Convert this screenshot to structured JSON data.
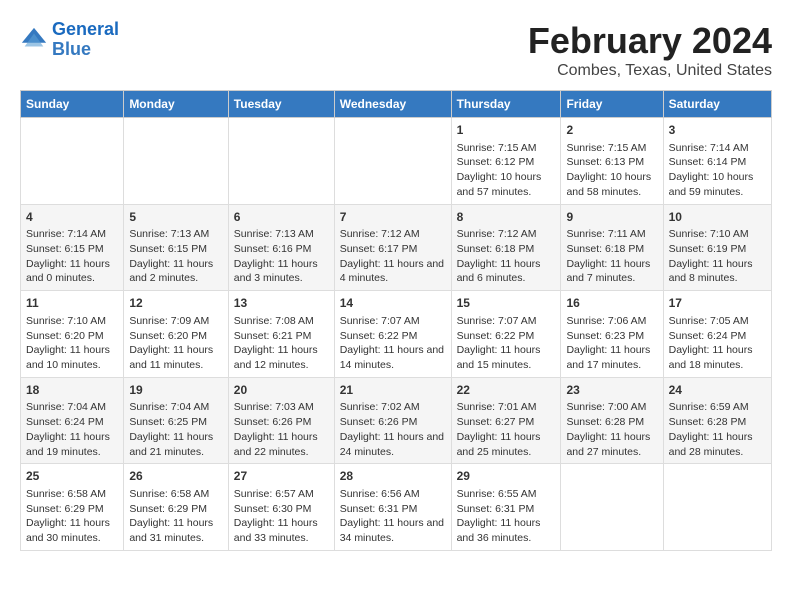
{
  "header": {
    "logo_line1": "General",
    "logo_line2": "Blue",
    "title": "February 2024",
    "subtitle": "Combes, Texas, United States"
  },
  "days_of_week": [
    "Sunday",
    "Monday",
    "Tuesday",
    "Wednesday",
    "Thursday",
    "Friday",
    "Saturday"
  ],
  "weeks": [
    [
      {
        "day": "",
        "info": ""
      },
      {
        "day": "",
        "info": ""
      },
      {
        "day": "",
        "info": ""
      },
      {
        "day": "",
        "info": ""
      },
      {
        "day": "1",
        "info": "Sunrise: 7:15 AM\nSunset: 6:12 PM\nDaylight: 10 hours and 57 minutes."
      },
      {
        "day": "2",
        "info": "Sunrise: 7:15 AM\nSunset: 6:13 PM\nDaylight: 10 hours and 58 minutes."
      },
      {
        "day": "3",
        "info": "Sunrise: 7:14 AM\nSunset: 6:14 PM\nDaylight: 10 hours and 59 minutes."
      }
    ],
    [
      {
        "day": "4",
        "info": "Sunrise: 7:14 AM\nSunset: 6:15 PM\nDaylight: 11 hours and 0 minutes."
      },
      {
        "day": "5",
        "info": "Sunrise: 7:13 AM\nSunset: 6:15 PM\nDaylight: 11 hours and 2 minutes."
      },
      {
        "day": "6",
        "info": "Sunrise: 7:13 AM\nSunset: 6:16 PM\nDaylight: 11 hours and 3 minutes."
      },
      {
        "day": "7",
        "info": "Sunrise: 7:12 AM\nSunset: 6:17 PM\nDaylight: 11 hours and 4 minutes."
      },
      {
        "day": "8",
        "info": "Sunrise: 7:12 AM\nSunset: 6:18 PM\nDaylight: 11 hours and 6 minutes."
      },
      {
        "day": "9",
        "info": "Sunrise: 7:11 AM\nSunset: 6:18 PM\nDaylight: 11 hours and 7 minutes."
      },
      {
        "day": "10",
        "info": "Sunrise: 7:10 AM\nSunset: 6:19 PM\nDaylight: 11 hours and 8 minutes."
      }
    ],
    [
      {
        "day": "11",
        "info": "Sunrise: 7:10 AM\nSunset: 6:20 PM\nDaylight: 11 hours and 10 minutes."
      },
      {
        "day": "12",
        "info": "Sunrise: 7:09 AM\nSunset: 6:20 PM\nDaylight: 11 hours and 11 minutes."
      },
      {
        "day": "13",
        "info": "Sunrise: 7:08 AM\nSunset: 6:21 PM\nDaylight: 11 hours and 12 minutes."
      },
      {
        "day": "14",
        "info": "Sunrise: 7:07 AM\nSunset: 6:22 PM\nDaylight: 11 hours and 14 minutes."
      },
      {
        "day": "15",
        "info": "Sunrise: 7:07 AM\nSunset: 6:22 PM\nDaylight: 11 hours and 15 minutes."
      },
      {
        "day": "16",
        "info": "Sunrise: 7:06 AM\nSunset: 6:23 PM\nDaylight: 11 hours and 17 minutes."
      },
      {
        "day": "17",
        "info": "Sunrise: 7:05 AM\nSunset: 6:24 PM\nDaylight: 11 hours and 18 minutes."
      }
    ],
    [
      {
        "day": "18",
        "info": "Sunrise: 7:04 AM\nSunset: 6:24 PM\nDaylight: 11 hours and 19 minutes."
      },
      {
        "day": "19",
        "info": "Sunrise: 7:04 AM\nSunset: 6:25 PM\nDaylight: 11 hours and 21 minutes."
      },
      {
        "day": "20",
        "info": "Sunrise: 7:03 AM\nSunset: 6:26 PM\nDaylight: 11 hours and 22 minutes."
      },
      {
        "day": "21",
        "info": "Sunrise: 7:02 AM\nSunset: 6:26 PM\nDaylight: 11 hours and 24 minutes."
      },
      {
        "day": "22",
        "info": "Sunrise: 7:01 AM\nSunset: 6:27 PM\nDaylight: 11 hours and 25 minutes."
      },
      {
        "day": "23",
        "info": "Sunrise: 7:00 AM\nSunset: 6:28 PM\nDaylight: 11 hours and 27 minutes."
      },
      {
        "day": "24",
        "info": "Sunrise: 6:59 AM\nSunset: 6:28 PM\nDaylight: 11 hours and 28 minutes."
      }
    ],
    [
      {
        "day": "25",
        "info": "Sunrise: 6:58 AM\nSunset: 6:29 PM\nDaylight: 11 hours and 30 minutes."
      },
      {
        "day": "26",
        "info": "Sunrise: 6:58 AM\nSunset: 6:29 PM\nDaylight: 11 hours and 31 minutes."
      },
      {
        "day": "27",
        "info": "Sunrise: 6:57 AM\nSunset: 6:30 PM\nDaylight: 11 hours and 33 minutes."
      },
      {
        "day": "28",
        "info": "Sunrise: 6:56 AM\nSunset: 6:31 PM\nDaylight: 11 hours and 34 minutes."
      },
      {
        "day": "29",
        "info": "Sunrise: 6:55 AM\nSunset: 6:31 PM\nDaylight: 11 hours and 36 minutes."
      },
      {
        "day": "",
        "info": ""
      },
      {
        "day": "",
        "info": ""
      }
    ]
  ]
}
